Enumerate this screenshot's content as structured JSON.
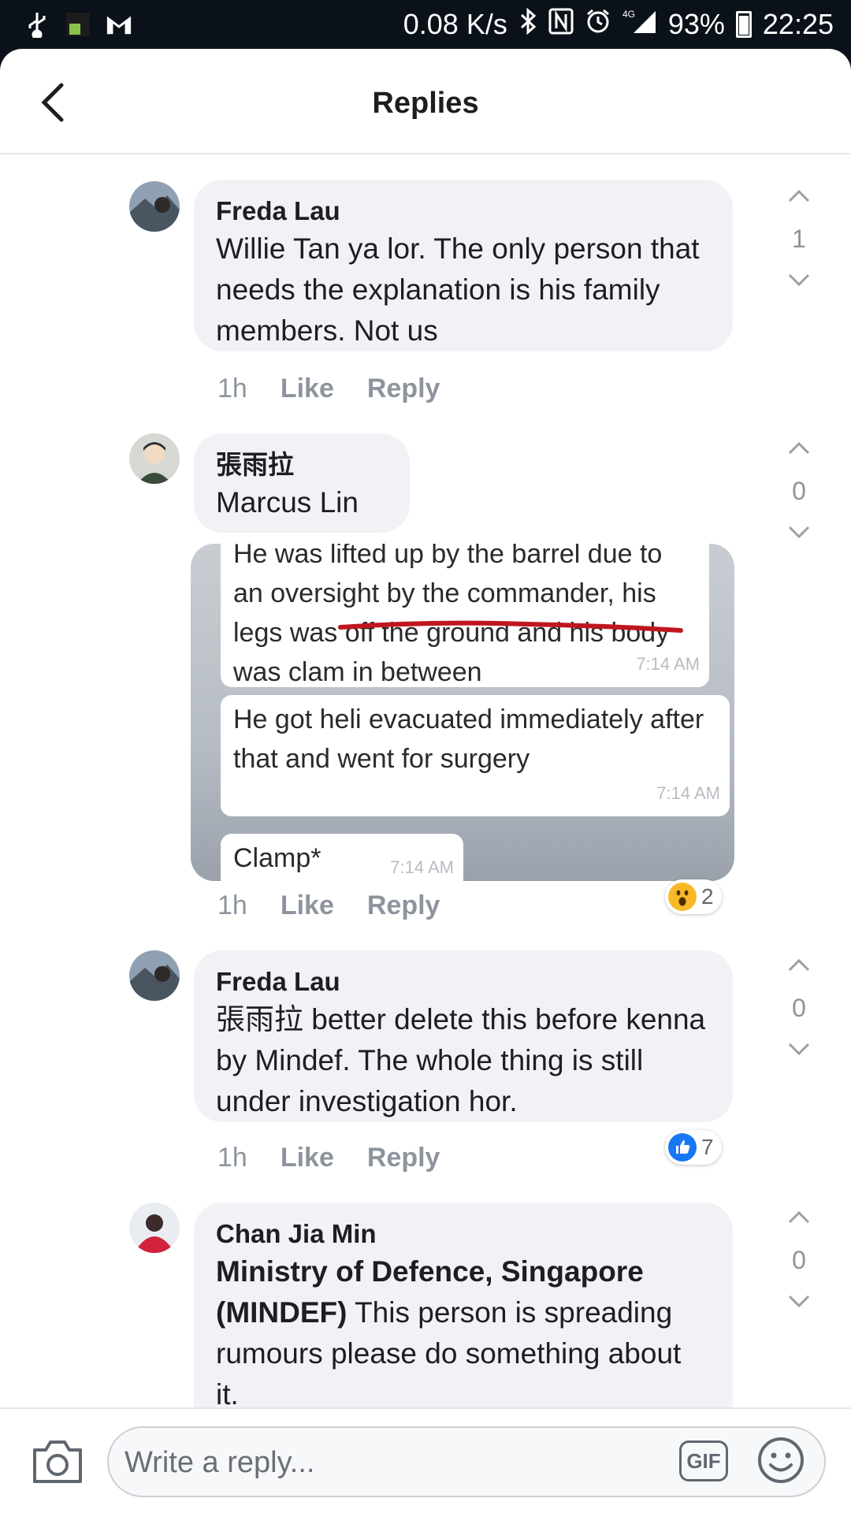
{
  "status_bar": {
    "net_speed": "0.08 K/s",
    "network": "4G",
    "battery": "93%",
    "time": "22:25"
  },
  "header": {
    "title": "Replies"
  },
  "comments": [
    {
      "author": "Freda Lau",
      "text": "Willie Tan ya lor. The only person that needs the explanation is his family members. Not us",
      "time": "1h",
      "like": "Like",
      "reply": "Reply",
      "votes": "1"
    },
    {
      "author": "張雨拉",
      "text": "Marcus Lin",
      "time": "1h",
      "like": "Like",
      "reply": "Reply",
      "votes": "0",
      "reaction_count": "2"
    },
    {
      "author": "Freda Lau",
      "text_mention": "張雨拉",
      "text": " better delete this before kenna by Mindef. The whole thing is still under investigation hor.",
      "time": "1h",
      "like": "Like",
      "reply": "Reply",
      "votes": "0",
      "reaction_count": "7"
    },
    {
      "author": "Chan Jia Min",
      "text_mention": "Ministry of Defence, Singapore (MINDEF)",
      "text": " This person is spreading rumours please do something about it.",
      "votes": "0"
    }
  ],
  "attachment": {
    "messages": [
      {
        "text": "He was lifted up by the barrel due to an oversight by the commander, his legs was off the ground and his body was clam in between",
        "time": "7:14 AM"
      },
      {
        "text": "He got heli evacuated immediately after that and went for surgery",
        "time": "7:14 AM"
      },
      {
        "text": "Clamp*",
        "time": "7:14 AM"
      }
    ]
  },
  "composer": {
    "placeholder": "Write a reply...",
    "gif_label": "GIF"
  },
  "colors": {
    "like_blue": "#1877f2",
    "highlight_red": "#c0161f",
    "bubble_gray": "#f0f2f5"
  },
  "icons": [
    "usb-icon",
    "notification-icon",
    "gmail-icon",
    "bluetooth-icon",
    "nfc-icon",
    "alarm-icon",
    "signal-icon",
    "battery-icon",
    "back-icon",
    "camera-icon",
    "emoji-icon",
    "wow-reaction-icon",
    "like-reaction-icon",
    "chevron-up-icon",
    "chevron-down-icon"
  ]
}
